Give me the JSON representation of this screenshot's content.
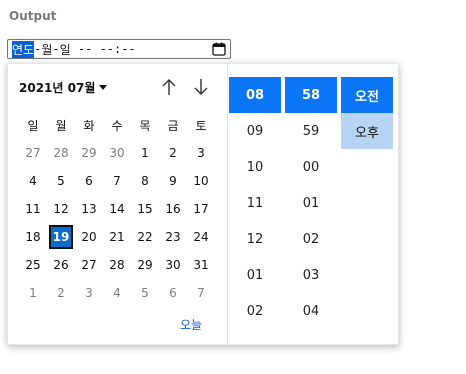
{
  "section_title": "Output",
  "input": {
    "year_placeholder": "연도",
    "month_placeholder": "월",
    "day_placeholder": "일",
    "hour_placeholder": "--",
    "minute_placeholder": "--",
    "ampm_placeholder": "--",
    "icon": "calendar-icon"
  },
  "calendar": {
    "month_label": "2021년 07월",
    "weekdays": [
      "일",
      "월",
      "화",
      "수",
      "목",
      "금",
      "토"
    ],
    "days": [
      {
        "d": "27",
        "muted": true
      },
      {
        "d": "28",
        "muted": true
      },
      {
        "d": "29",
        "muted": true
      },
      {
        "d": "30",
        "muted": true
      },
      {
        "d": "1"
      },
      {
        "d": "2"
      },
      {
        "d": "3"
      },
      {
        "d": "4"
      },
      {
        "d": "5"
      },
      {
        "d": "6"
      },
      {
        "d": "7"
      },
      {
        "d": "8"
      },
      {
        "d": "9"
      },
      {
        "d": "10"
      },
      {
        "d": "11"
      },
      {
        "d": "12"
      },
      {
        "d": "13"
      },
      {
        "d": "14"
      },
      {
        "d": "15"
      },
      {
        "d": "16"
      },
      {
        "d": "17"
      },
      {
        "d": "18"
      },
      {
        "d": "19",
        "selected": true
      },
      {
        "d": "20"
      },
      {
        "d": "21"
      },
      {
        "d": "22"
      },
      {
        "d": "23"
      },
      {
        "d": "24"
      },
      {
        "d": "25"
      },
      {
        "d": "26"
      },
      {
        "d": "27"
      },
      {
        "d": "28"
      },
      {
        "d": "29"
      },
      {
        "d": "30"
      },
      {
        "d": "31"
      },
      {
        "d": "1",
        "muted": true
      },
      {
        "d": "2",
        "muted": true
      },
      {
        "d": "3",
        "muted": true
      },
      {
        "d": "4",
        "muted": true
      },
      {
        "d": "5",
        "muted": true
      },
      {
        "d": "6",
        "muted": true
      },
      {
        "d": "7",
        "muted": true
      }
    ],
    "today_label": "오늘"
  },
  "time": {
    "hours": [
      "08",
      "09",
      "10",
      "11",
      "12",
      "01",
      "02"
    ],
    "hours_selected": "08",
    "minutes": [
      "58",
      "59",
      "00",
      "01",
      "02",
      "03",
      "04"
    ],
    "minutes_selected": "58",
    "ampm": [
      "오전",
      "오후"
    ],
    "ampm_selected": "오전",
    "ampm_secondary": "오후"
  },
  "colors": {
    "accent": "#0a76f5",
    "selected_day": "#0a6cd1",
    "secondary_highlight": "#b7d4f4",
    "link": "#0a63c4"
  }
}
